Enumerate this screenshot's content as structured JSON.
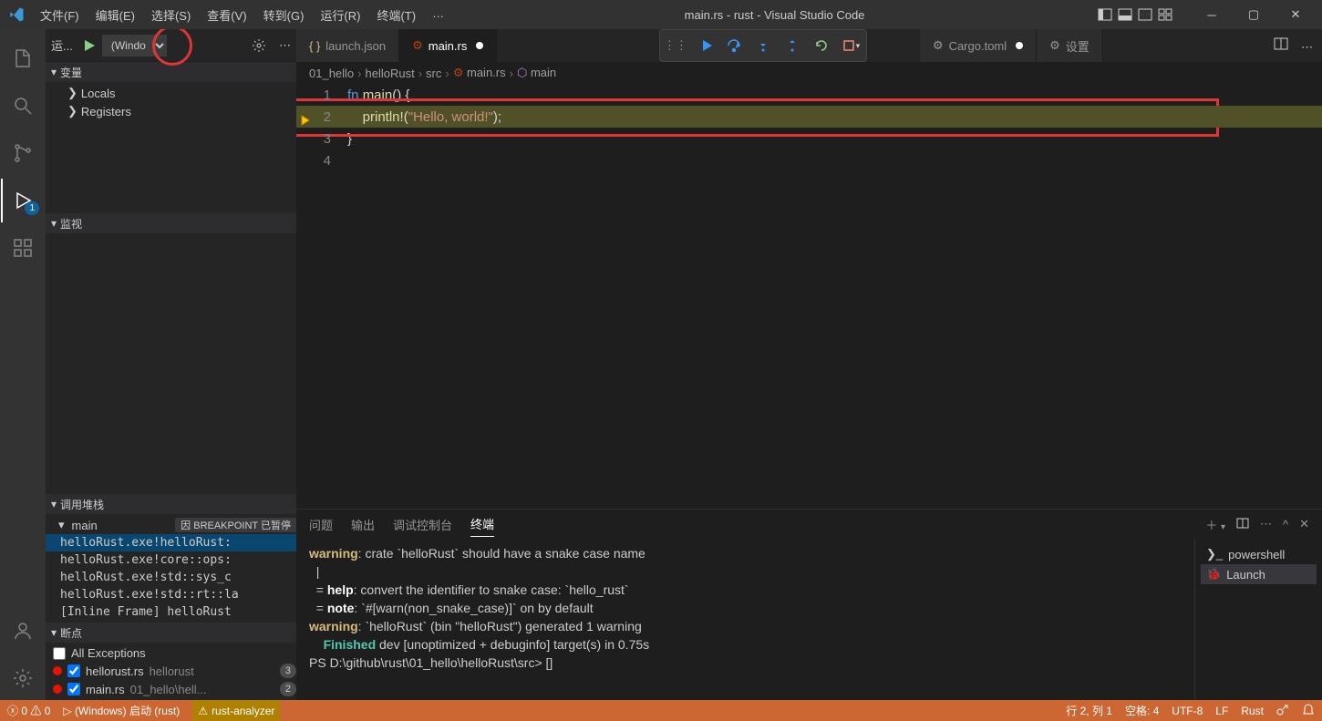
{
  "window": {
    "title": "main.rs - rust - Visual Studio Code"
  },
  "menu": [
    "文件(F)",
    "编辑(E)",
    "选择(S)",
    "查看(V)",
    "转到(G)",
    "运行(R)",
    "终端(T)",
    "…"
  ],
  "debugToolbar": {
    "label": "运...",
    "config": "(Windo"
  },
  "sections": {
    "variables": "变量",
    "locals": "Locals",
    "registers": "Registers",
    "watch": "监视",
    "callstack": "调用堆栈",
    "breakpoints": "断点"
  },
  "callstack": {
    "thread": "main",
    "reason": "因 BREAKPOINT 已暂停",
    "frames": [
      "helloRust.exe!helloRust:",
      "helloRust.exe!core::ops:",
      "helloRust.exe!std::sys_c",
      "helloRust.exe!std::rt::la",
      "[Inline Frame] helloRust"
    ]
  },
  "breakpoints": {
    "allExceptions": "All Exceptions",
    "items": [
      {
        "file": "hellorust.rs",
        "folder": "hellorust",
        "count": "3"
      },
      {
        "file": "main.rs",
        "folder": "01_hello\\hell...",
        "count": "2"
      }
    ]
  },
  "tabs": [
    {
      "label": "launch.json",
      "icon": "braces",
      "active": false
    },
    {
      "label": "main.rs",
      "icon": "rust",
      "active": true,
      "dirty": true
    },
    {
      "label": "Cargo.toml",
      "icon": "gear",
      "active": false,
      "dirty": true
    },
    {
      "label": "设置",
      "icon": "settings",
      "active": false
    }
  ],
  "breadcrumbs": [
    "01_hello",
    "helloRust",
    "src",
    "main.rs",
    "main"
  ],
  "editor": {
    "lines": [
      {
        "n": 1,
        "html": "<span class='kw'>fn</span> <span class='fn'>main</span><span class='pn'>() {</span>"
      },
      {
        "n": 2,
        "html": "    <span class='fn'>println!</span><span class='pn'>(</span><span class='str'>\"Hello, world!\"</span><span class='pn'>);</span>",
        "hl": true
      },
      {
        "n": 3,
        "html": "<span class='pn'>}</span>"
      },
      {
        "n": 4,
        "html": ""
      }
    ]
  },
  "panel": {
    "tabs": [
      "问题",
      "输出",
      "调试控制台",
      "终端"
    ],
    "active": 3,
    "side": [
      {
        "icon": "term",
        "label": "powershell"
      },
      {
        "icon": "debug",
        "label": "Launch"
      }
    ],
    "terminal_lines": [
      {
        "cls": "",
        "pre": "",
        "t": ""
      },
      {
        "cls": "warn",
        "pre": "warning",
        "t": ": crate `helloRust` should have a snake case name"
      },
      {
        "cls": "",
        "pre": "",
        "t": "  |"
      },
      {
        "cls": "",
        "pre": "  = ",
        "b": "help",
        "t": ": convert the identifier to snake case: `hello_rust`"
      },
      {
        "cls": "",
        "pre": "  = ",
        "b": "note",
        "t": ": `#[warn(non_snake_case)]` on by default"
      },
      {
        "cls": "",
        "pre": "",
        "t": ""
      },
      {
        "cls": "warn",
        "pre": "warning",
        "t": ": `helloRust` (bin \"helloRust\") generated 1 warning"
      },
      {
        "cls": "green",
        "pre": "    Finished",
        "t": " dev [unoptimized + debuginfo] target(s) in 0.75s"
      },
      {
        "cls": "",
        "pre": "",
        "t": "PS D:\\github\\rust\\01_hello\\helloRust\\src> []"
      }
    ]
  },
  "status": {
    "errors": "0",
    "warnings": "0",
    "launch": "(Windows) 启动 (rust)",
    "analyzer": "rust-analyzer",
    "pos": "行 2, 列 1",
    "spaces": "空格: 4",
    "enc": "UTF-8",
    "eol": "LF",
    "lang": "Rust"
  }
}
